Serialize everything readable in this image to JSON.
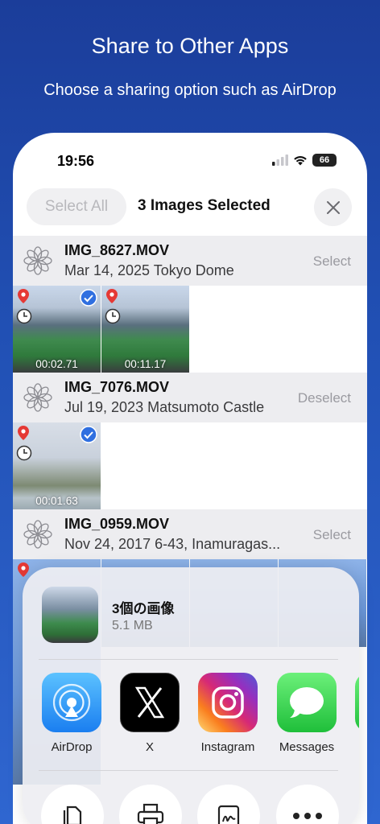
{
  "promo": {
    "title": "Share to Other Apps",
    "subtitle": "Choose a sharing option such as AirDrop"
  },
  "status_bar": {
    "time": "19:56",
    "battery": "66"
  },
  "header": {
    "select_all": "Select All",
    "title": "3 Images Selected"
  },
  "groups": [
    {
      "name": "IMG_8627.MOV",
      "desc": "Mar 14, 2025 Tokyo Dome",
      "action": "Select",
      "thumbs": [
        {
          "duration": "00:02.71",
          "selected": true
        },
        {
          "duration": "00:11.17",
          "selected": false
        }
      ]
    },
    {
      "name": "IMG_7076.MOV",
      "desc": "Jul 19, 2023 Matsumoto Castle",
      "action": "Deselect",
      "thumbs": [
        {
          "duration": "00:01.63",
          "selected": true
        }
      ]
    },
    {
      "name": "IMG_0959.MOV",
      "desc": "Nov 24, 2017 6-43, Inamuragas...",
      "action": "Select"
    }
  ],
  "share_sheet": {
    "title": "3個の画像",
    "size": "5.1 MB",
    "apps": [
      {
        "label": "AirDrop",
        "icon": "airdrop-icon"
      },
      {
        "label": "X",
        "icon": "x-icon"
      },
      {
        "label": "Instagram",
        "icon": "instagram-icon"
      },
      {
        "label": "Messages",
        "icon": "messages-icon"
      }
    ],
    "actions": [
      {
        "icon": "copy-icon"
      },
      {
        "icon": "print-icon"
      },
      {
        "icon": "markup-icon"
      },
      {
        "icon": "more-icon"
      }
    ]
  },
  "colors": {
    "background": "#2150b4",
    "check_blue": "#2f6fe0",
    "pin_red": "#e53935"
  }
}
